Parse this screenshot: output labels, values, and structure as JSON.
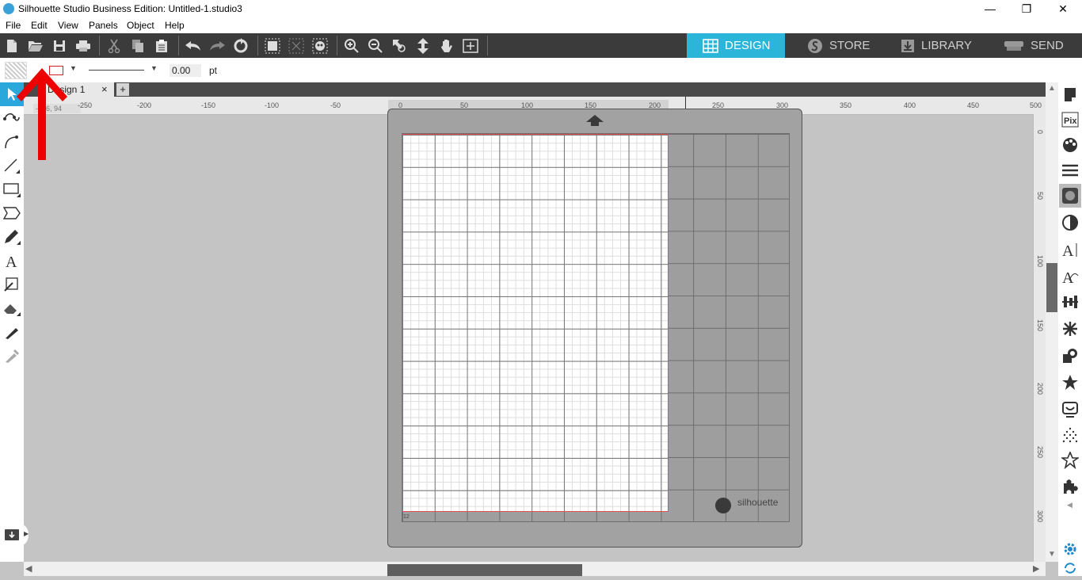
{
  "window": {
    "title": "Silhouette Studio Business Edition: Untitled-1.studio3",
    "controls": {
      "minimize": "—",
      "maximize": "❐",
      "close": "✕"
    }
  },
  "menu": [
    "File",
    "Edit",
    "View",
    "Panels",
    "Object",
    "Help"
  ],
  "toolbar": {
    "icons": [
      "new-document-icon",
      "open-folder-icon",
      "save-icon",
      "print-icon",
      "cut-icon",
      "copy-icon",
      "paste-icon",
      "undo-icon",
      "redo-icon",
      "replicate-icon",
      "group-icon",
      "ungroup-icon",
      "compound-path-icon",
      "zoom-in-icon",
      "zoom-out-icon",
      "zoom-select-icon",
      "fit-to-page-icon",
      "pan-hand-icon",
      "fit-window-icon"
    ],
    "nav": [
      {
        "label": "DESIGN",
        "icon": "grid-icon",
        "active": true
      },
      {
        "label": "STORE",
        "icon": "silhouette-s-icon",
        "active": false
      },
      {
        "label": "LIBRARY",
        "icon": "library-download-icon",
        "active": false
      },
      {
        "label": "SEND",
        "icon": "cutter-icon",
        "active": false
      }
    ]
  },
  "options": {
    "line_width": "0.00",
    "unit": "pt",
    "line_color": "#cc2222"
  },
  "tab": {
    "label": "Design 1",
    "close": "×",
    "add": "+",
    "coord_readout": "-236, 94"
  },
  "ruler": {
    "h_labels": [
      "-250",
      "-200",
      "-150",
      "-100",
      "-50",
      "0",
      "50",
      "100",
      "150",
      "200",
      "250",
      "300",
      "350",
      "400",
      "450",
      "500"
    ],
    "v_labels": [
      "0",
      "50",
      "100",
      "150",
      "200",
      "250",
      "300"
    ]
  },
  "mat": {
    "brand": "silhouette",
    "corner_label": "12"
  },
  "colors": {
    "active_nav": "#2bb6d9",
    "toolbar_bg": "#3b3b3b",
    "annotation_arrow": "#ee0000",
    "panel_accent": "#1e88c8"
  }
}
